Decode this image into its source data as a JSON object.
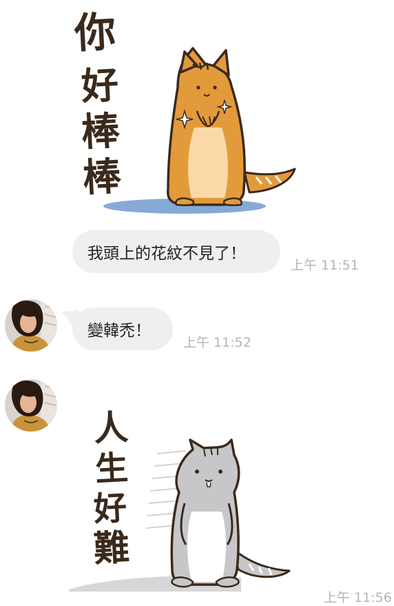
{
  "stickers": {
    "first": {
      "caption_chars": [
        "你",
        "好",
        "棒",
        "棒"
      ],
      "description_icon": "orange-cat-sticker-icon"
    },
    "second": {
      "caption_chars": [
        "人",
        "生",
        "好",
        "難"
      ],
      "description_icon": "gray-cat-sticker-icon"
    }
  },
  "messages": [
    {
      "text": "我頭上的花紋不見了！",
      "time": "上午 11:51",
      "has_avatar": false
    },
    {
      "text": "變韓禿！",
      "time": "上午 11:52",
      "has_avatar": true
    }
  ],
  "last_sticker_time": "上午 11:56",
  "colors": {
    "bubble_bg": "#efefef",
    "timestamp": "#b4b4b4",
    "orange_cat": "#e39a3b",
    "gray_cat": "#c7c7c9",
    "shadow_blue": "#86a9d6"
  }
}
